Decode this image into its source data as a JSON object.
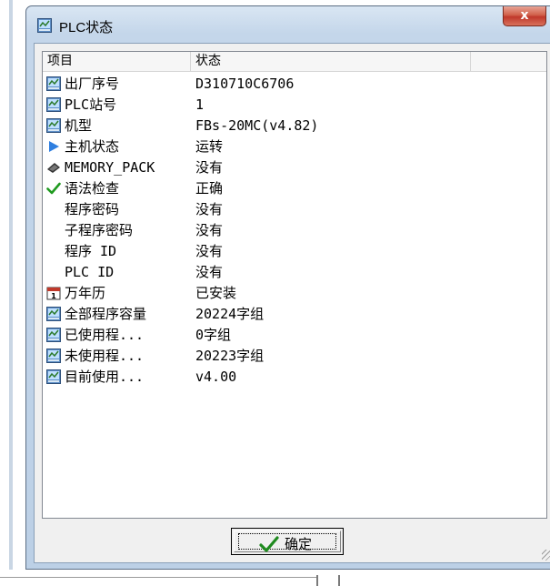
{
  "window": {
    "title": "PLC状态",
    "close_label": "x"
  },
  "columns": [
    "项目",
    "状态",
    ""
  ],
  "rows": [
    {
      "icon": "plc-icon",
      "name": "出厂序号",
      "status": "D310710C6706"
    },
    {
      "icon": "plc-icon",
      "name": "PLC站号",
      "status": "1"
    },
    {
      "icon": "plc-icon",
      "name": "机型",
      "status": "FBs-20MC(v4.82)"
    },
    {
      "icon": "play-arrow-icon",
      "name": "主机状态",
      "status": "运转"
    },
    {
      "icon": "memory-chip-icon",
      "name": "MEMORY_PACK",
      "status": "没有"
    },
    {
      "icon": "checkmark-icon",
      "name": "语法检查",
      "status": "正确"
    },
    {
      "icon": "",
      "name": "程序密码",
      "status": "没有"
    },
    {
      "icon": "",
      "name": "子程序密码",
      "status": "没有"
    },
    {
      "icon": "",
      "name": "程序 ID",
      "status": "没有"
    },
    {
      "icon": "",
      "name": "PLC ID",
      "status": "没有"
    },
    {
      "icon": "calendar-icon",
      "name": "万年历",
      "status": "已安装"
    },
    {
      "icon": "plc-icon",
      "name": "全部程序容量",
      "status": "20224字组"
    },
    {
      "icon": "plc-icon",
      "name": "已使用程...",
      "status": "0字组"
    },
    {
      "icon": "plc-icon",
      "name": "未使用程...",
      "status": "20223字组"
    },
    {
      "icon": "plc-icon",
      "name": "目前使用...",
      "status": "v4.00"
    }
  ],
  "ok_button": {
    "label": "确定",
    "icon": "checkmark-icon"
  }
}
